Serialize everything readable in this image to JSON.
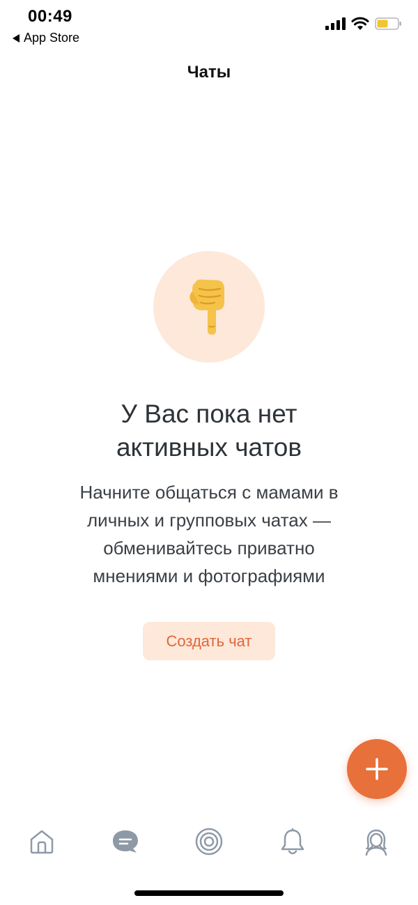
{
  "status_bar": {
    "time": "00:49",
    "back_label": "App Store"
  },
  "header": {
    "title": "Чаты"
  },
  "empty_state": {
    "emoji": "👇",
    "heading_line1": "У Вас пока нет",
    "heading_line2": "активных чатов",
    "text_line1": "Начните общаться с мамами в",
    "text_line2": "личных и групповых чатах —",
    "text_line3": "обменивайтесь приватно",
    "text_line4": "мнениями и фотографиями",
    "button_label": "Создать чат"
  },
  "colors": {
    "accent": "#e8703a",
    "accent_soft": "#fde8da",
    "accent_text": "#e0663a",
    "tab_inactive": "#8e99a6",
    "tab_active": "#8e99a6"
  },
  "tabbar": {
    "items": [
      {
        "icon": "home-icon",
        "active": false
      },
      {
        "icon": "chat-icon",
        "active": true
      },
      {
        "icon": "target-icon",
        "active": false
      },
      {
        "icon": "bell-icon",
        "active": false
      },
      {
        "icon": "profile-icon",
        "active": false
      }
    ]
  }
}
